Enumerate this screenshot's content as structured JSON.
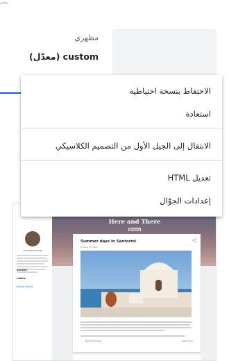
{
  "theme": {
    "label": "مظهري",
    "name": "custom (معدّل)"
  },
  "menu": {
    "items": [
      {
        "label": "الاحتفاظ بنسخة احتياطية"
      },
      {
        "label": "استعادة"
      },
      {
        "label": "الانتقال إلى الجيل الأول من التصميم الكلاسيكي"
      },
      {
        "label": "تعديل HTML"
      },
      {
        "label": "إعدادات الجوّال"
      }
    ]
  },
  "arrow": {
    "color": "#1a56db"
  },
  "preview": {
    "blog_title": "Here and There",
    "subscribe_label": "SUBSCRIBE",
    "author_name": "ELIZABETH HOME",
    "sidebar_links": [
      "Archive",
      "Labels"
    ],
    "report_label": "Report Abuse",
    "post_title": "Summer days in Santorini",
    "post_date": "October 19, 2016",
    "share_label": "Share",
    "read_more": "Read more",
    "comment_label": "Post a Comment"
  },
  "icons": {
    "top": "partial-icon",
    "arrow": "arrow-right-icon",
    "share": "share-icon"
  }
}
